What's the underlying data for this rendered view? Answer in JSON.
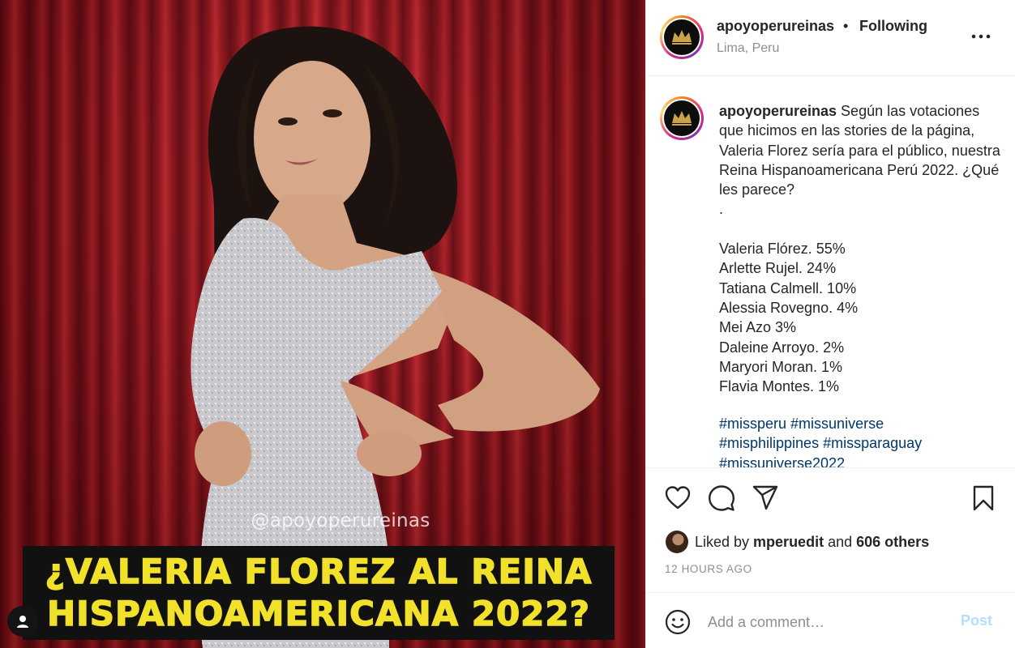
{
  "media": {
    "watermark": "@apoyoperureinas",
    "headline_line1": "¿VALERIA FLOREZ AL REINA",
    "headline_line2": "HISPANOAMERICANA 2022?",
    "curtain_color": "#b3161f",
    "headline_bg": "#111111",
    "headline_color": "#f2e12a"
  },
  "header": {
    "username": "apoyoperureinas",
    "separator": "•",
    "follow_status": "Following",
    "location": "Lima, Peru",
    "more_icon": "more-horizontal-icon"
  },
  "caption": {
    "username": "apoyoperureinas",
    "intro": " Según las votaciones que hicimos en las stories de la página, Valeria Florez sería para el público, nuestra Reina Hispanoamericana Perú 2022. ¿Qué les parece?",
    "dot": ".",
    "results": [
      "Valeria Flórez. 55%",
      "Arlette Rujel. 24%",
      "Tatiana Calmell. 10%",
      "Alessia Rovegno. 4%",
      "Mei Azo 3%",
      "Daleine Arroyo. 2%",
      "Maryori Moran. 1%",
      "Flavia Montes. 1%"
    ],
    "hashtags_line1": [
      "#missperu",
      "#missuniverse"
    ],
    "hashtags_line2": [
      "#misphilippines",
      "#missparaguay"
    ],
    "hashtags_line3": [
      "#missuniverse2022"
    ]
  },
  "actions": {
    "like_icon": "heart-icon",
    "comment_icon": "comment-icon",
    "share_icon": "send-icon",
    "save_icon": "bookmark-icon"
  },
  "likes": {
    "prefix": "Liked by ",
    "user": "mperuedit",
    "middle": " and ",
    "others": "606 others"
  },
  "timestamp": "12 HOURS AGO",
  "comment": {
    "placeholder": "Add a comment…",
    "post_label": "Post",
    "post_color": "#b2dffc"
  }
}
